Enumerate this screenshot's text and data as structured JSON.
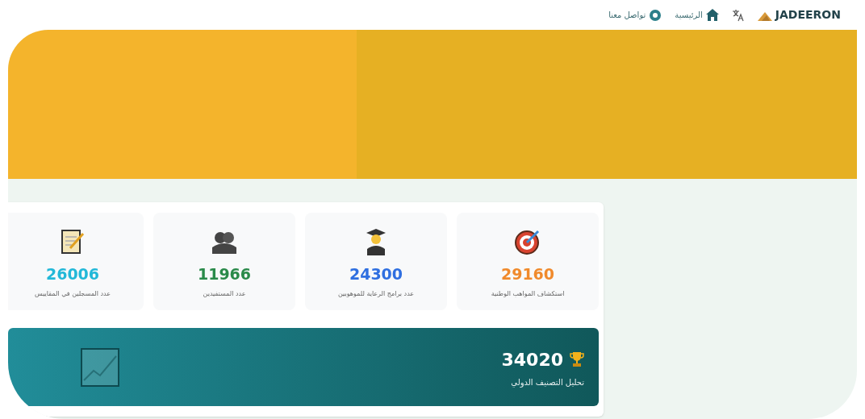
{
  "header": {
    "logo": "JADEERON",
    "nav": [
      {
        "label": "الرئيسية",
        "kind": "home"
      },
      {
        "label": "تواصل معنا",
        "kind": "contact"
      }
    ]
  },
  "stats": [
    {
      "value": "29160",
      "label": "استكشاف المواهب الوطنية",
      "color": "#f08a2c",
      "kind": "talent"
    },
    {
      "value": "24300",
      "label": "عدد برامج الرعاية للموهوبين",
      "color": "#2f6fe0",
      "kind": "programs"
    },
    {
      "value": "11966",
      "label": "عدد المستفيدين",
      "color": "#2a8a4a",
      "kind": "beneficiaries"
    },
    {
      "value": "26006",
      "label": "عدد المسجلين في المقاييس",
      "color": "#22b8d8",
      "kind": "registrations"
    }
  ],
  "ranking": {
    "value": "34020",
    "label": "تحليل التصنيف الدولي"
  }
}
